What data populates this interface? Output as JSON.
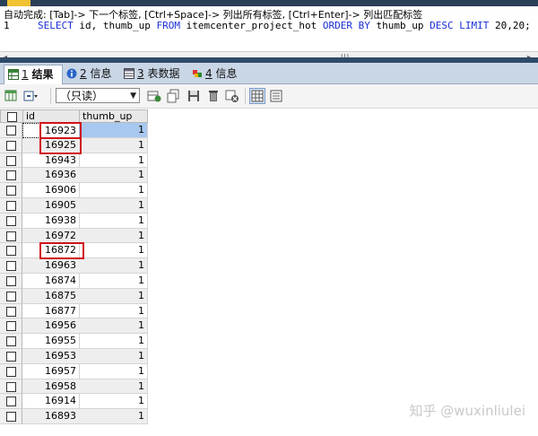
{
  "editor": {
    "hint": "自动完成: [Tab]-> 下一个标签, [Ctrl+Space]-> 列出所有标签, [Ctrl+Enter]-> 列出匹配标签",
    "line_number": "1",
    "sql_tokens": [
      {
        "t": "SELECT",
        "k": true
      },
      {
        "t": " id, thumb_up ",
        "k": false
      },
      {
        "t": "FROM",
        "k": true
      },
      {
        "t": " itemcenter_project_hot ",
        "k": false
      },
      {
        "t": "ORDER BY",
        "k": true
      },
      {
        "t": " thumb_up ",
        "k": false
      },
      {
        "t": "DESC LIMIT",
        "k": true
      },
      {
        "t": " 20,20;",
        "k": false
      }
    ]
  },
  "scrollbar": {
    "left_arrow": "◂",
    "right_arrow": "▸",
    "grip": "III"
  },
  "tabs": [
    {
      "num": "1",
      "label": "结果",
      "icon": "grid-result-icon",
      "active": true
    },
    {
      "num": "2",
      "label": "信息",
      "icon": "info-icon",
      "active": false
    },
    {
      "num": "3",
      "label": "表数据",
      "icon": "table-data-icon",
      "active": false
    },
    {
      "num": "4",
      "label": "信息",
      "icon": "info-alt-icon",
      "active": false
    }
  ],
  "toolbar": {
    "readonly_select": "（只读）"
  },
  "grid": {
    "columns": [
      "id",
      "thumb_up"
    ],
    "rows": [
      [
        "16923",
        "1"
      ],
      [
        "16925",
        "1"
      ],
      [
        "16943",
        "1"
      ],
      [
        "16936",
        "1"
      ],
      [
        "16906",
        "1"
      ],
      [
        "16905",
        "1"
      ],
      [
        "16938",
        "1"
      ],
      [
        "16972",
        "1"
      ],
      [
        "16872",
        "1"
      ],
      [
        "16963",
        "1"
      ],
      [
        "16874",
        "1"
      ],
      [
        "16875",
        "1"
      ],
      [
        "16877",
        "1"
      ],
      [
        "16956",
        "1"
      ],
      [
        "16955",
        "1"
      ],
      [
        "16953",
        "1"
      ],
      [
        "16957",
        "1"
      ],
      [
        "16958",
        "1"
      ],
      [
        "16914",
        "1"
      ],
      [
        "16893",
        "1"
      ]
    ],
    "selected_row": 0,
    "highlighted_rows": [
      0,
      1,
      8
    ]
  },
  "watermark": "知乎 @wuxinliulei",
  "colors": {
    "keyword": "#1a2fd6",
    "highlight_box": "#d0121b",
    "selection": "#a9c8ef"
  }
}
